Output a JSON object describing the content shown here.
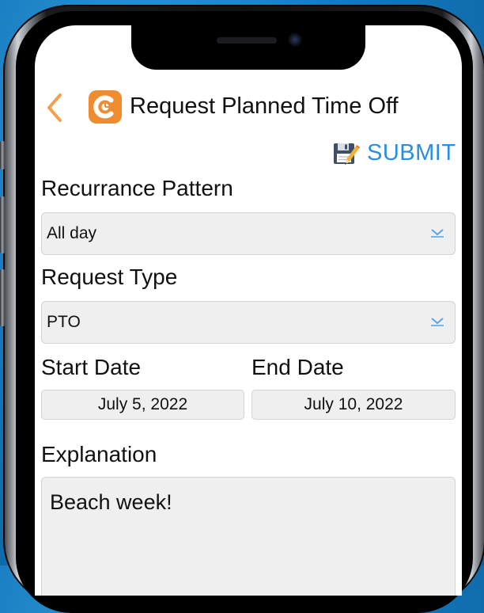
{
  "header": {
    "title": "Request Planned Time Off",
    "back_icon": "chevron-left-icon",
    "logo_icon": "clock-app-icon"
  },
  "toolbar": {
    "submit_label": "SUBMIT",
    "submit_icon": "save-edit-icon"
  },
  "form": {
    "recurrence": {
      "label": "Recurrance Pattern",
      "value": "All day"
    },
    "request_type": {
      "label": "Request Type",
      "value": "PTO"
    },
    "start_date": {
      "label": "Start Date",
      "value": "July 5, 2022"
    },
    "end_date": {
      "label": "End Date",
      "value": "July 10, 2022"
    },
    "explanation": {
      "label": "Explanation",
      "value": "Beach week!"
    }
  },
  "colors": {
    "accent_orange": "#ee8c2f",
    "submit_blue": "#2a8ee0",
    "field_background": "#efefef",
    "background_blue": "#1479bd"
  }
}
